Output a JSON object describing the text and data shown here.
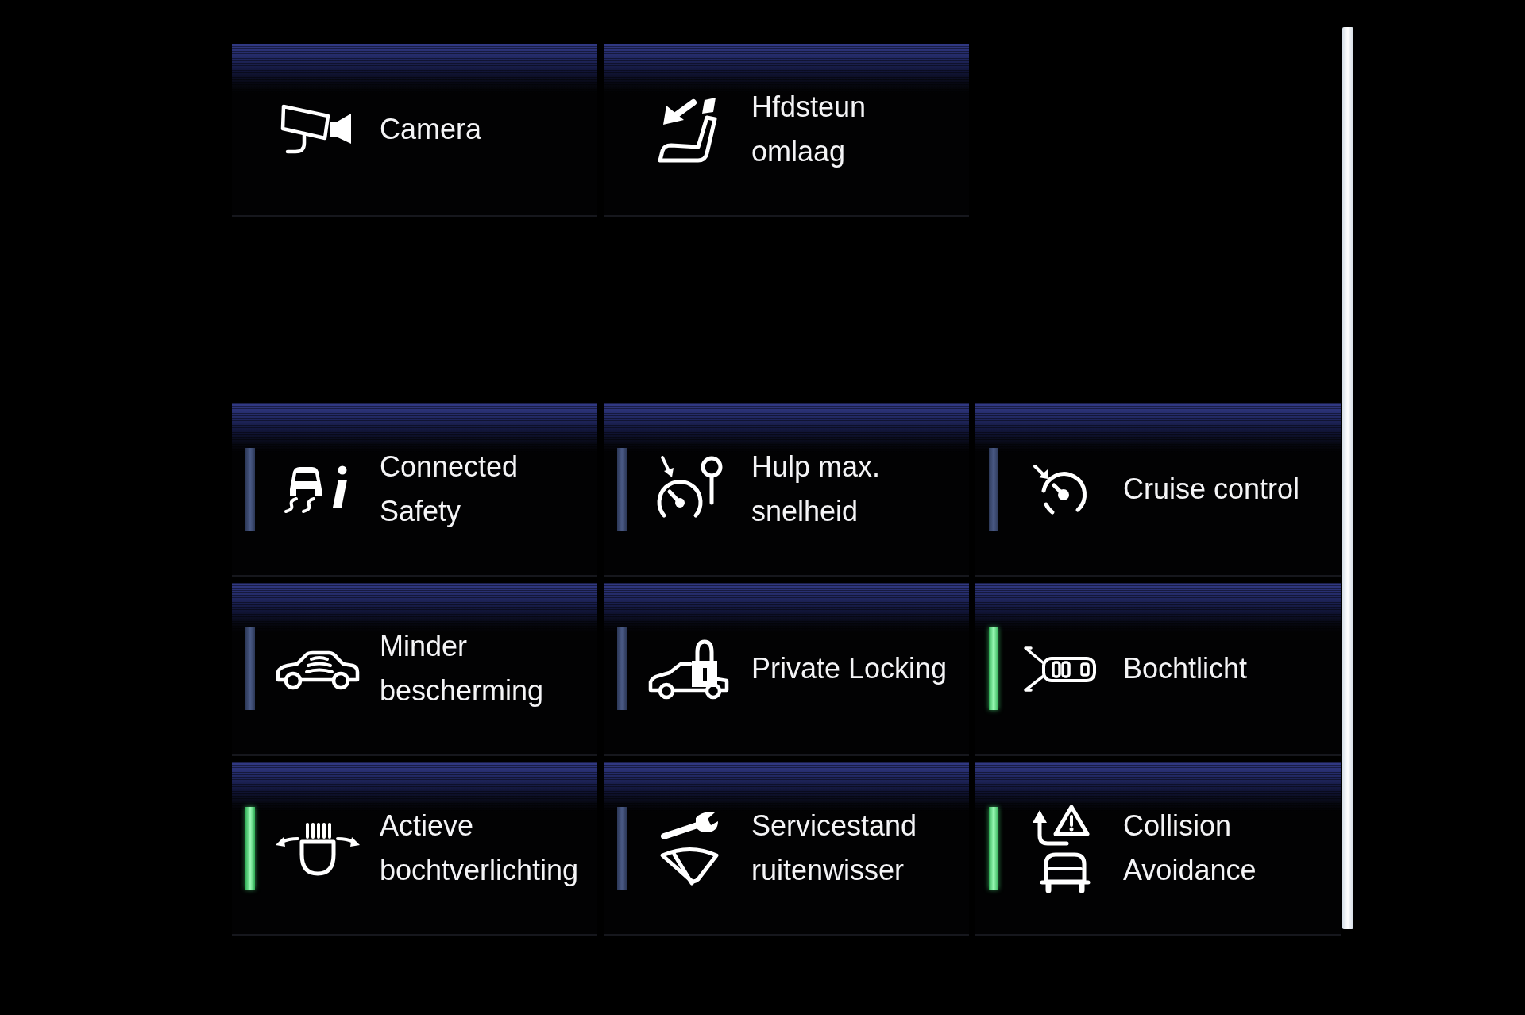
{
  "actions": [
    {
      "label": "Camera"
    },
    {
      "label": "Hfdsteun omlaag"
    }
  ],
  "toggles": [
    {
      "label": "Connected Safety",
      "on": false
    },
    {
      "label": "Hulp max. snelheid",
      "on": false
    },
    {
      "label": "Cruise control",
      "on": false
    },
    {
      "label": "Minder bescherming",
      "on": false
    },
    {
      "label": "Private Locking",
      "on": false
    },
    {
      "label": "Bochtlicht",
      "on": true
    },
    {
      "label": "Actieve bochtverlichting",
      "on": true
    },
    {
      "label": "Servicestand ruitenwisser",
      "on": false
    },
    {
      "label": "Collision Avoidance",
      "on": true
    }
  ]
}
